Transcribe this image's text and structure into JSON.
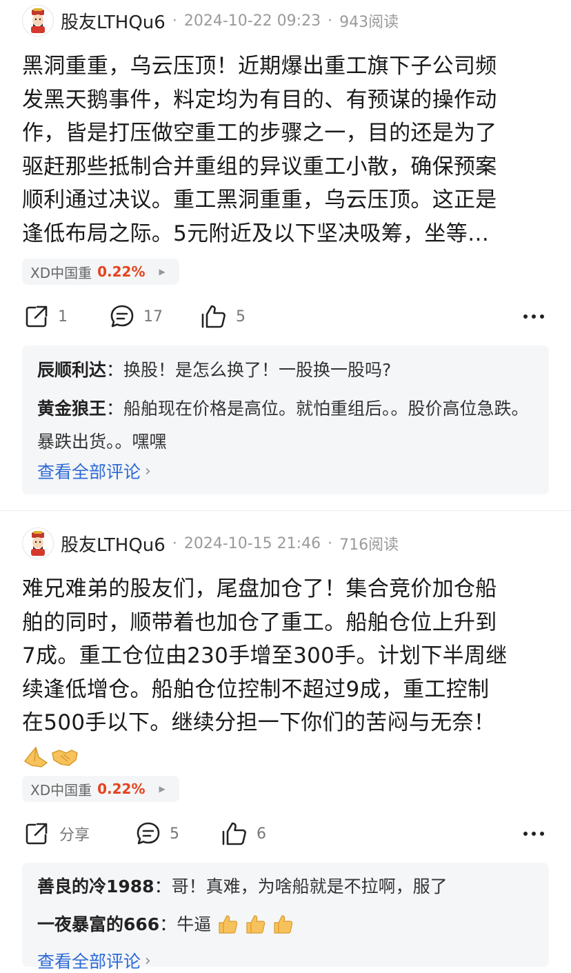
{
  "posts": [
    {
      "username": "股友LTHQu6",
      "timestamp": "2024-10-22 09:23",
      "reads": "943阅读",
      "content_lines": [
        "黑洞重重，乌云压顶！近期爆出重工旗下子公司频",
        "发黑天鹅事件，料定均为有目的、有预谋的操作动",
        "作，皆是打压做空重工的步骤之一，目的还是为了",
        "驱赶那些抵制合并重组的异议重工小散，确保预案",
        "顺利通过决议。重工黑洞重重，乌云压顶。这正是",
        "逢低布局之际。5元附近及以下坚决吸筹，坐等…"
      ],
      "stock_name": "XD中国重",
      "stock_change": "0.22%",
      "share_label": "1",
      "comment_count": "17",
      "like_count": "5",
      "comments": [
        {
          "author": "辰顺利达",
          "text": "换股！是怎么换了！一股换一股吗?"
        },
        {
          "author": "黄金狼王",
          "text": "船舶现在价格是高位。就怕重组后。。股价高位急跌。暴跌出货。。嘿嘿"
        }
      ],
      "see_all_label": "查看全部评论"
    },
    {
      "username": "股友LTHQu6",
      "timestamp": "2024-10-15 21:46",
      "reads": "716阅读",
      "content_lines": [
        "难兄难弟的股友们，尾盘加仓了！集合竞价加仓船",
        "舶的同时，顺带着也加仓了重工。船舶仓位上升到",
        "7成。重工仓位由230手增至300手。计划下半周继",
        "续逢低增仓。船舶仓位控制不超过9成，重工控制",
        "在500手以下。继续分担一下你们的苦闷与无奈！"
      ],
      "emojis": [
        "folded-hands-emoji",
        "handshake-emoji"
      ],
      "stock_name": "XD中国重",
      "stock_change": "0.22%",
      "share_label": "分享",
      "comment_count": "5",
      "like_count": "6",
      "comments": [
        {
          "author": "善良的冷1988",
          "text": "哥！真难，为啥船就是不拉啊，服了"
        },
        {
          "author": "一夜暴富的666",
          "text": "牛逼"
        }
      ],
      "see_all_label": "查看全部评论"
    }
  ],
  "colors": {
    "accent_blue": "#2d6ad6",
    "stock_up_red": "#e5431d",
    "muted_gray": "#9a9a9a",
    "comment_bg": "#f5f6f8"
  },
  "icons": [
    "avatar-god-of-wealth",
    "share-icon",
    "comment-icon",
    "like-icon",
    "more-icon",
    "chevron-right-icon",
    "thumbs-up-emoji"
  ]
}
